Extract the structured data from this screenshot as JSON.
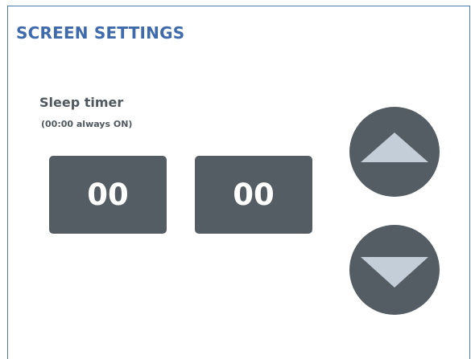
{
  "screen": {
    "title": "SCREEN SETTINGS"
  },
  "sleep_timer": {
    "label": "Sleep timer",
    "hint": "(00:00 always ON)",
    "hours": "00",
    "minutes": "00"
  },
  "controls": {
    "up_icon": "triangle-up-icon",
    "down_icon": "triangle-down-icon"
  },
  "colors": {
    "title": "#3f6aab",
    "frame": "#4d79b4",
    "control_background": "#545d64",
    "arrow": "#c3ced8",
    "label": "#50585f"
  }
}
